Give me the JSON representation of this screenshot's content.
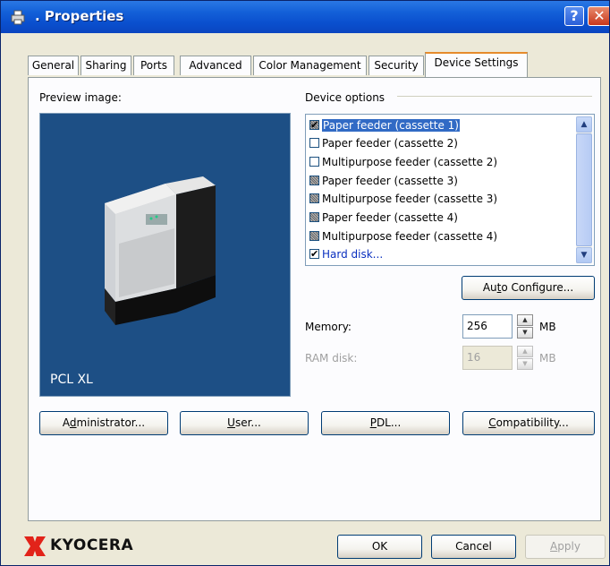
{
  "window": {
    "title": ". Properties",
    "help_icon": "help-icon",
    "close_icon": "close-icon"
  },
  "tabs": [
    {
      "label": "General"
    },
    {
      "label": "Sharing"
    },
    {
      "label": "Ports"
    },
    {
      "label": "Advanced"
    },
    {
      "label": "Color Management"
    },
    {
      "label": "Security"
    },
    {
      "label": "Device Settings",
      "active": true
    }
  ],
  "preview": {
    "label": "Preview image:",
    "caption": "PCL XL",
    "image": "printer-image"
  },
  "device_options": {
    "label": "Device options",
    "items": [
      {
        "label": "Paper feeder (cassette 1)",
        "checked": true,
        "enabled": false,
        "selected": true
      },
      {
        "label": "Paper feeder (cassette 2)",
        "checked": false,
        "enabled": true
      },
      {
        "label": "Multipurpose feeder (cassette 2)",
        "checked": false,
        "enabled": true
      },
      {
        "label": "Paper feeder (cassette 3)",
        "checked": false,
        "enabled": false
      },
      {
        "label": "Multipurpose feeder (cassette 3)",
        "checked": false,
        "enabled": false
      },
      {
        "label": "Paper feeder (cassette 4)",
        "checked": false,
        "enabled": false
      },
      {
        "label": "Multipurpose feeder (cassette 4)",
        "checked": false,
        "enabled": false
      },
      {
        "label": "Hard disk...",
        "checked": true,
        "enabled": true
      }
    ],
    "auto_configure": {
      "pre": "Au",
      "u": "t",
      "post": "o Configure..."
    }
  },
  "memory": {
    "label": "Memory:",
    "value": "256",
    "unit": "MB"
  },
  "ram_disk": {
    "label": "RAM disk:",
    "value": "16",
    "unit": "MB",
    "enabled": false
  },
  "buttons": {
    "administrator": {
      "pre": "A",
      "u": "d",
      "post": "ministrator..."
    },
    "user": {
      "pre": "",
      "u": "U",
      "post": "ser..."
    },
    "pdl": {
      "pre": "",
      "u": "P",
      "post": "DL..."
    },
    "compatibility": {
      "pre": "",
      "u": "C",
      "post": "ompatibility..."
    }
  },
  "footer": {
    "brand": "KYOCERA",
    "brand_color": "#e2231a",
    "ok": "OK",
    "cancel": "Cancel",
    "apply": {
      "pre": "",
      "u": "A",
      "post": "pply"
    }
  }
}
